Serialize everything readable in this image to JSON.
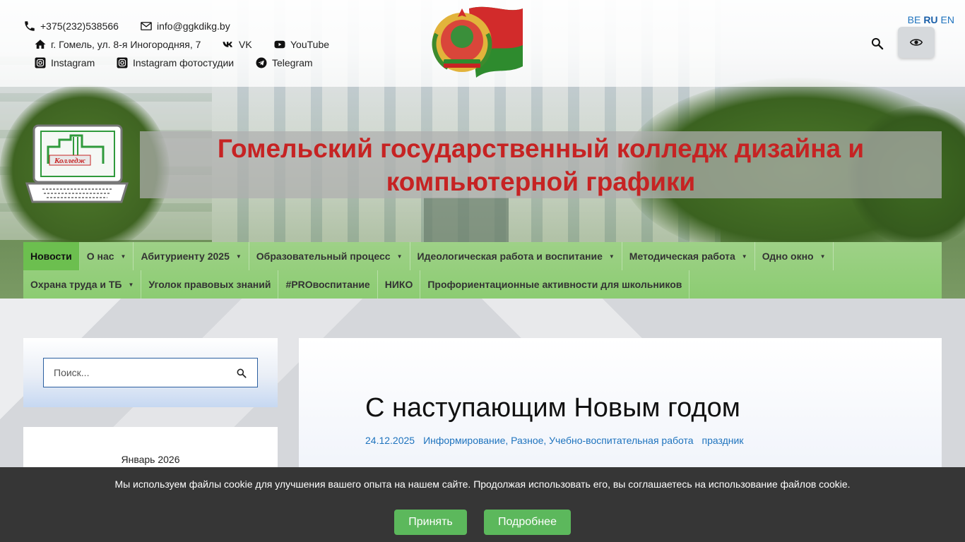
{
  "contacts": {
    "phone": "+375(232)538566",
    "email": "info@ggkdikg.by",
    "address": "г. Гомель, ул. 8-я Иногородняя, 7",
    "vk": "VK",
    "youtube": "YouTube",
    "instagram": "Instagram",
    "instagram_photo": "Instagram фотостудии",
    "telegram": "Telegram"
  },
  "languages": [
    {
      "code": "BE",
      "active": false
    },
    {
      "code": "RU",
      "active": true
    },
    {
      "code": "EN",
      "active": false
    }
  ],
  "site_title": "Гомельский государственный колледж дизайна и компьютерной графики",
  "logo_text": "Колледж",
  "nav": {
    "row1": [
      {
        "label": "Новости",
        "dropdown": false,
        "active": true
      },
      {
        "label": "О нас",
        "dropdown": true
      },
      {
        "label": "Абитуриенту 2025",
        "dropdown": true
      },
      {
        "label": "Образовательный процесс",
        "dropdown": true
      },
      {
        "label": "Идеологическая работа и воспитание",
        "dropdown": true
      },
      {
        "label": "Методическая работа",
        "dropdown": true
      },
      {
        "label": "Одно окно",
        "dropdown": true
      }
    ],
    "row2": [
      {
        "label": "Охрана труда и ТБ",
        "dropdown": true
      },
      {
        "label": "Уголок правовых знаний",
        "dropdown": false
      },
      {
        "label": "#PROвоспитание",
        "dropdown": false
      },
      {
        "label": "НИКО",
        "dropdown": false
      },
      {
        "label": "Профориентационные активности для школьников",
        "dropdown": false
      }
    ]
  },
  "sidebar": {
    "search_placeholder": "Поиск...",
    "calendar_caption": "Январь 2026"
  },
  "article": {
    "title": "С наступающим Новым годом",
    "date": "24.12.2025",
    "categories": "Информирование, Разное, Учебно-воспитательная работа",
    "tag": "праздник"
  },
  "cookie": {
    "text": "Мы используем файлы cookie для улучшения вашего опыта на нашем сайте. Продолжая использовать его, вы соглашаетесь на использование файлов cookie.",
    "accept_label": "Принять",
    "more_label": "Подробнее"
  },
  "colors": {
    "title_red": "#c62323",
    "nav_green": "#8ccc72",
    "nav_active": "#6cbf4f",
    "link_blue": "#1e73be",
    "cookie_bg": "#363636",
    "button_green": "#5cb85c"
  }
}
